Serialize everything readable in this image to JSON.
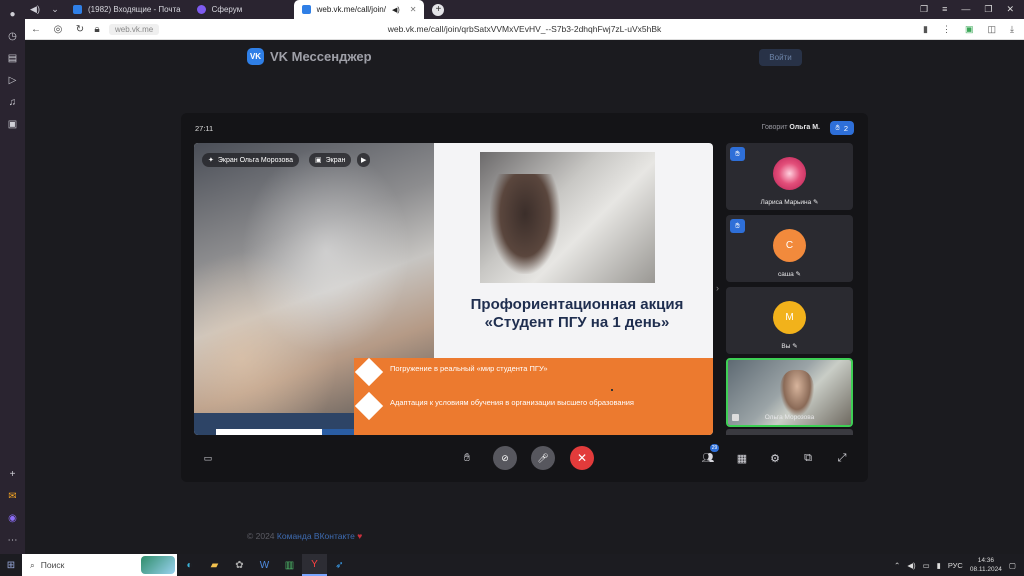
{
  "tabs": [
    {
      "title": "(1982) Входящие - Почта",
      "favicon_color": "#2f7fe6"
    },
    {
      "title": "Сферум",
      "favicon_color": "#7e5bef"
    },
    {
      "title": "web.vk.me/call/join/",
      "favicon_color": "#2f7fe6"
    }
  ],
  "addressbar": {
    "domain_chip": "web.vk.me",
    "url": "web.vk.me/call/join/qrbSatxVVMxVEvHV_--S7b3-2dhqhFwj7zL-uVx5hBk"
  },
  "header": {
    "logo_text": "VK",
    "title": "VK Мессенджер",
    "login": "Войти"
  },
  "call": {
    "timer": "27:11",
    "speaking_label": "Говорит",
    "speaking_name": "Ольга М.",
    "raised_hands": "2",
    "screen_owner_chip": "Экран Ольга Морозова",
    "screen_chip": "Экран",
    "slide": {
      "title_line1": "Профориентационная акция",
      "title_line2": "«Студент ПГУ на 1 день»",
      "bullet1": "Погружение  в реальный «мир студента ПГУ»",
      "bullet2": "Адаптация к  условиям обучения  в организации высшего образования"
    },
    "participants": [
      {
        "name": "Лариса Марьина",
        "initial": "",
        "avatar_color": "#e34f7a",
        "hand_raised": true
      },
      {
        "name": "саша",
        "initial": "С",
        "avatar_color": "#f28a3c",
        "hand_raised": true
      },
      {
        "name": "Вы",
        "initial": "М",
        "avatar_color": "#f2b21b",
        "hand_raised": false
      },
      {
        "name": "Ольга Морозова",
        "initial": "",
        "avatar_color": "",
        "hand_raised": false,
        "active": true
      }
    ],
    "participants_badge": "29"
  },
  "footer": {
    "copyright": "© 2024",
    "team": "Команда ВКонтакте"
  },
  "taskbar": {
    "search": "Поиск",
    "lang": "РУС",
    "time": "14:36",
    "date": "08.11.2024"
  },
  "icons": {
    "raise_hand": "hand-icon",
    "camera_off": "camera-off-icon",
    "mic_off": "mic-off-icon",
    "end_call": "close-icon",
    "participants": "people-icon",
    "grid": "grid-icon",
    "settings": "gear-icon",
    "pip": "pip-icon",
    "fullscreen": "fullscreen-icon"
  }
}
